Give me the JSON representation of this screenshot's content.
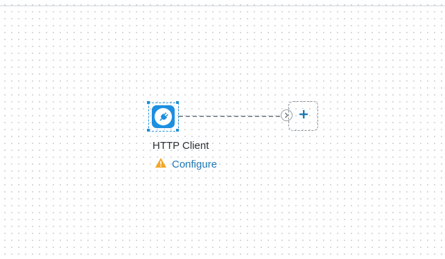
{
  "canvas": {
    "node": {
      "title": "HTTP Client",
      "icon": "plug-icon",
      "status_icon": "warning-icon",
      "configure_label": "Configure"
    },
    "add_step_icon": "plus-icon",
    "connector_icon": "chevron-right-icon"
  },
  "colors": {
    "accent": "#1e8fe0",
    "link": "#1d78b3",
    "warning": "#f5a623",
    "connector": "#8a8f96"
  }
}
